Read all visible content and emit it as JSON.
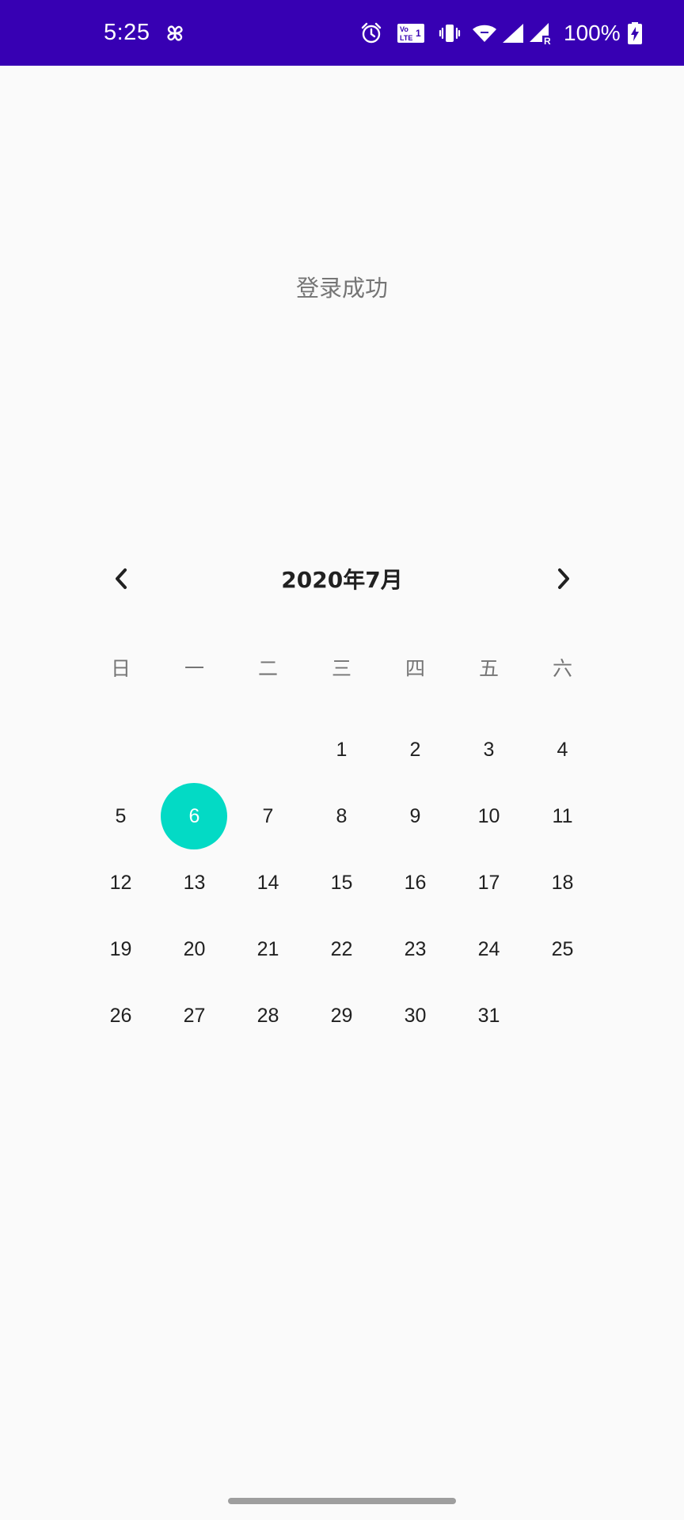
{
  "status_bar": {
    "time": "5:25",
    "battery_percent": "100%",
    "background_color": "#3700b3",
    "icons": [
      "pinwheel-icon",
      "alarm-icon",
      "volte-icon",
      "vibrate-icon",
      "wifi-icon",
      "signal-icon",
      "signal-roaming-icon",
      "battery-charging-icon"
    ]
  },
  "main": {
    "message": "登录成功"
  },
  "calendar": {
    "title": "2020年7月",
    "prev_icon": "chevron-left-icon",
    "next_icon": "chevron-right-icon",
    "weekdays": [
      "日",
      "一",
      "二",
      "三",
      "四",
      "五",
      "六"
    ],
    "days": [
      "",
      "",
      "",
      "1",
      "2",
      "3",
      "4",
      "5",
      "6",
      "7",
      "8",
      "9",
      "10",
      "11",
      "12",
      "13",
      "14",
      "15",
      "16",
      "17",
      "18",
      "19",
      "20",
      "21",
      "22",
      "23",
      "24",
      "25",
      "26",
      "27",
      "28",
      "29",
      "30",
      "31",
      ""
    ],
    "selected_day": "6",
    "selected_color": "#03dac5"
  }
}
